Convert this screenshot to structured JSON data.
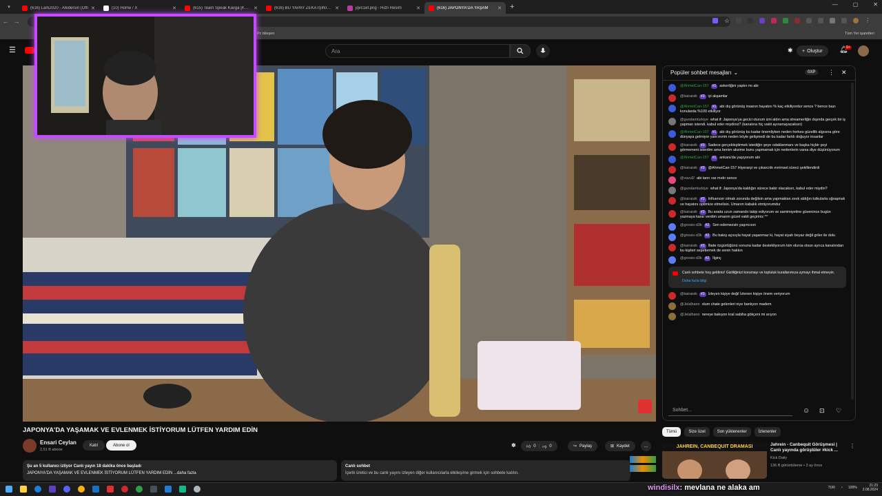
{
  "browser": {
    "tabs": [
      {
        "title": "(616) Lark2020 - Afedersin (Offi",
        "color": "#ff0000"
      },
      {
        "title": "(10) Home / X",
        "color": "#ffffff"
      },
      {
        "title": "(615) Team Speak Kavga [Kopm",
        "color": "#ff0000"
      },
      {
        "title": "(616) BU YAPAY ZEKA İŞİNİN TA",
        "color": "#ff0000"
      },
      {
        "title": "jqvc1ef.png - Hızlı Resim",
        "color": "#b33ea8"
      },
      {
        "title": "(616) JAPONYA'DA YAŞAM",
        "color": "#ff0000",
        "active": true
      }
    ],
    "new_tab": "+",
    "bookmarks": [
      "Pc bileşen"
    ],
    "all_bookmarks": "Tüm Yer işaretleri"
  },
  "youtube": {
    "search_placeholder": "Ara",
    "create_label": "Oluştur",
    "notif_count": "9+"
  },
  "video": {
    "title": "JAPONYA'DA YAŞAMAK VE EVLENMEK İSTİYORUM LÜTFEN YARDIM EDİN",
    "channel": "Ensari Ceylan",
    "subscribers": "2,51 B abone",
    "join": "Katıl",
    "subscribe": "Abone ol",
    "likes": "0",
    "dislikes": "0",
    "share": "Paylaş",
    "save": "Kaydet",
    "more": "...",
    "desc_line1": "Şu an 5 kullanıcı izliyor  Canlı yayın 18 dakika önce başladı",
    "desc_line2": "JAPONYA'DA YAŞAMAK VE EVLENMEK İSTİYORUM LÜTFEN YARDIM EDİN ...daha fazla",
    "livechat_title": "Canlı sohbet",
    "livechat_text": "İçerik üretici ve bu canlı yayını izleyen diğer kullanıcılarla etkileşime girmek için sohbete katılın."
  },
  "chat": {
    "header": "Popüler sohbet mesajları",
    "xp": "0XP",
    "input_placeholder": "Sohbet...",
    "messages": [
      {
        "name": "@AhmetCan-157",
        "badge": "#1",
        "text": "askerliğini yaptın mı abi",
        "avcolor": "#3b5bdb",
        "green": true
      },
      {
        "name": "@kairaisik",
        "badge": "#3",
        "text": "iyi akşamlar",
        "avcolor": "#c92a2a"
      },
      {
        "name": "@AhmetCan-157",
        "badge": "#1",
        "text": "abi dış görünüş insanın hayatını % kaç etkiliyordur sence ? bence bazı konularda %100 etkiliyor",
        "avcolor": "#3b5bdb",
        "green": true
      },
      {
        "name": "@gundamturkiye",
        "badge": "",
        "text": "what if: Japonya'ya gecici oturum izni aldın ama streamerliğin dışında gerçek bir iş yapman istendi. kabul eder miydiniz? (kanalına hiç vakit ayıramayacaksın)",
        "avcolor": "#777777"
      },
      {
        "name": "@AhmetCan-157",
        "badge": "#1",
        "text": "abi dış görünüş bu kadar önemliyken neden herkes güzellik algısına göre dünyaya gelmiyor yani evrim neden böyle gelişmedi de bu kadar farklı doğuyor insanlar",
        "avcolor": "#3b5bdb",
        "green": true
      },
      {
        "name": "@kairaisik",
        "badge": "#3",
        "text": "Sadece gerçekleştirmek istediğin şeye odaklanmanı ve başka hiçbir şeyi görmemeni isterdim ama benim aksime bunu yapmamak için nedenlerin varsa diye düşünüyorum",
        "avcolor": "#c92a2a"
      },
      {
        "name": "@AhmetCan-157",
        "badge": "#1",
        "text": "ankara'da yaşıyorum abi",
        "avcolor": "#3b5bdb",
        "green": true
      },
      {
        "name": "@kairaisik",
        "badge": "#3",
        "text": "@AhmetCan-157 Hiyerarşi ve çıkarcılık evrimsel süreci şekillendirdi",
        "avcolor": "#c92a2a"
      },
      {
        "name": "@vavul2",
        "badge": "",
        "text": "abi tanrı var mıdır sence",
        "avcolor": "#e64980"
      },
      {
        "name": "@gundamturkiye",
        "badge": "",
        "text": "what if: Japonya'da kaldığın sürece bakir olacaksın, kabul eder miydin?",
        "avcolor": "#777777"
      },
      {
        "name": "@kairaisik",
        "badge": "#3",
        "text": "Influencer olmak zorunda değilsin ama yapmaktan zevk aldığın tutkularla uğraşmalı ve hayatını optimize etmelisin. Umarım kabalık etmiyorumdur",
        "avcolor": "#c92a2a"
      },
      {
        "name": "@kairaisik",
        "badge": "#3",
        "text": "Bu arada uzun zamandır takip ediyorum ve samimiyetine güvenince bugün yazmaya karar verdim umarım güzel vakit geçiriniz ^^",
        "avcolor": "#c92a2a"
      },
      {
        "name": "@gnosis-d3k",
        "badge": "#2",
        "text": "Sen edemezsin yaşıncısın",
        "avcolor": "#5c7cfa"
      },
      {
        "name": "@gnosis-d3k",
        "badge": "#2",
        "text": "Bu bakış açısıyla hayat yaşanmaz ki, hayat siyah beyaz değil griler ile dolu",
        "avcolor": "#5c7cfa"
      },
      {
        "name": "@kairaisik",
        "badge": "#3",
        "text": "İfade özgürlüğünü sonuna kadar destekliyorum kim olursa olsun ayrıca kanalından bu kişileri sepetlemek de senin hakkın",
        "avcolor": "#c92a2a"
      },
      {
        "name": "@gnosis-d3k",
        "badge": "#2",
        "text": "İlginç",
        "avcolor": "#5c7cfa"
      }
    ],
    "notice_text": "Canlı sohbete hoş geldiniz! Gizliliğinizi korumayı ve topluluk kurallarımıza uymayı ihmal etmeyin.",
    "notice_link": "Daha fazla bilgi",
    "messages2": [
      {
        "name": "@kairaisik",
        "badge": "#3",
        "text": "İzleyen kişiye değil İzlenen kişiye önem veriyorum",
        "avcolor": "#c92a2a"
      },
      {
        "name": "@Jelalhann",
        "badge": "",
        "text": "olum chate gelenleri niye banlıyon madem",
        "avcolor": "#8d6e3a"
      },
      {
        "name": "@Jelalhann",
        "badge": "",
        "text": "nereye bakıyon kral sabiha gökçeni mi arıyon",
        "avcolor": "#8d6e3a"
      }
    ]
  },
  "chips": [
    "Tümü",
    "Size özel",
    "Son yüklenenler",
    "İzlenenler"
  ],
  "recommendation": {
    "thumb_text": "JAHREIN, CANBEQUIT DRAMASI",
    "title": "Jahrein - Canbequit Görüşmesi | Canlı yayında görüştüler #kick ...",
    "channel": "Kick Daily",
    "meta": "136 B görüntüleme • 3 ay önce"
  },
  "stream_overlay": {
    "username": "windisilx",
    "message": ": mevlana ne alaka am"
  },
  "taskbar": {
    "time": "21:23",
    "date": "2.08.2024",
    "lang": "TUR",
    "battery": "100%"
  }
}
